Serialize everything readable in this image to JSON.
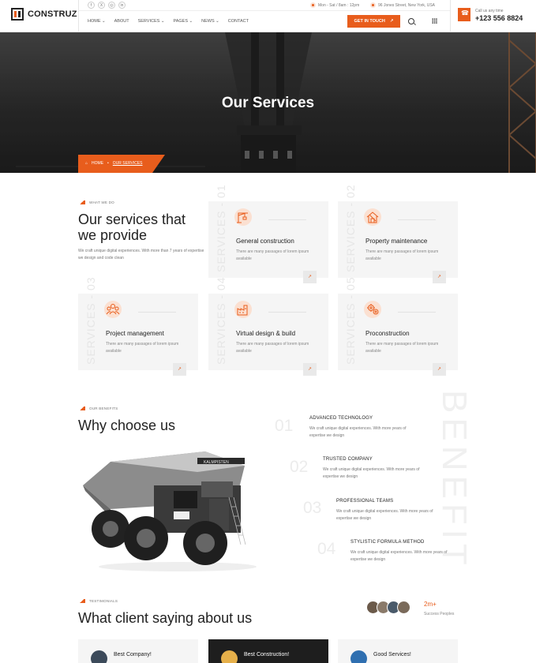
{
  "colors": {
    "accent": "#e85d1c",
    "dark": "#1e1e1e",
    "card": "#f5f5f5"
  },
  "header": {
    "logo": "CONSTRUZ",
    "social": [
      "f",
      "X",
      "◎",
      "in"
    ],
    "hours": "Mon - Sat / 8am : 12pm",
    "address": "96 Jones Street, New York, USA",
    "nav": [
      "HOME ⌄",
      "ABOUT",
      "SERVICES ⌄",
      "PAGES ⌄",
      "NEWS ⌄",
      "CONTACT"
    ],
    "cta": "GET IN TOUCH",
    "cta_icon": "↗",
    "call_label": "Call us any time",
    "call_number": "+123 556 8824"
  },
  "hero": {
    "title": "Our Services",
    "crumb_home": "HOME",
    "crumb_sep": "•",
    "crumb_current": "OUR SERVICES"
  },
  "services": {
    "tag": "WHAT WE DO",
    "heading_line1": "Our services that",
    "heading_line2": "we provide",
    "intro": "We craft unique digital experiences. With more than 7 years of expertise we design and code clean",
    "cards": [
      {
        "num": "SERVICES - 01",
        "title": "General construction",
        "desc": "There are many passages of lorem ipsum available",
        "icon": "crane-icon",
        "arrow": "↗"
      },
      {
        "num": "SERVICES - 02",
        "title": "Property maintenance",
        "desc": "There are many passages of lorem ipsum available",
        "icon": "house-tools-icon",
        "arrow": "↗"
      },
      {
        "num": "SERVICES - 03",
        "title": "Project management",
        "desc": "There are many passages of lorem ipsum available",
        "icon": "team-icon",
        "arrow": "↗"
      },
      {
        "num": "SERVICES - 04",
        "title": "Virtual design & build",
        "desc": "There are many passages of lorem ipsum available",
        "icon": "factory-icon",
        "arrow": "↗"
      },
      {
        "num": "SERVICES - 05",
        "title": "Proconstruction",
        "desc": "There are many passages of lorem ipsum available",
        "icon": "gears-icon",
        "arrow": "↗"
      }
    ]
  },
  "why": {
    "tag": "OUR BENEFITS",
    "heading": "Why choose us",
    "watermark": "BENEFIT",
    "truck_plate": "KALMPISTEN",
    "items": [
      {
        "num": "01",
        "title": "ADVANCED TECHNOLOGY",
        "desc": "We craft unique digital experiences. With more years of expertise we design"
      },
      {
        "num": "02",
        "title": "TRUSTED COMPANY",
        "desc": "We craft unique digital experiences. With more years of expertise we design"
      },
      {
        "num": "03",
        "title": "PROFESSIONAL TEAMS",
        "desc": "We craft unique digital experiences. With more years of expertise we design"
      },
      {
        "num": "04",
        "title": "STYLISTIC FORMULA METHOD",
        "desc": "We craft unique digital experiences. With more years of expertise we design"
      }
    ]
  },
  "testimonials": {
    "tag": "TESTIMONIALS",
    "heading": "What client saying about us",
    "stat_value": "2m+",
    "stat_label": "Success Peoples",
    "cards": [
      {
        "name": "Best Company!"
      },
      {
        "name": "Best Construction!"
      },
      {
        "name": "Good Services!"
      }
    ]
  }
}
